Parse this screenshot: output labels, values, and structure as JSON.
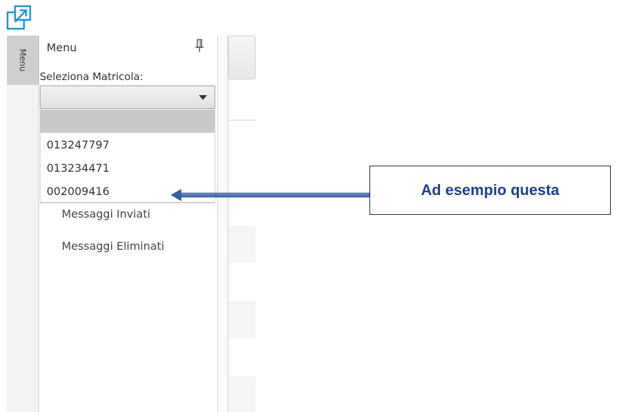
{
  "header": {
    "expand_icon": "expand-window-icon"
  },
  "side_tab": {
    "label": "Menu"
  },
  "menu": {
    "title": "Menu",
    "pin_icon": "pin-icon",
    "matricola_label": "Seleziona Matricola:",
    "selected_value": "",
    "options": [
      "013247797",
      "013234471",
      "002009416"
    ],
    "items": [
      "Messaggi Inviati",
      "Messaggi Eliminati"
    ]
  },
  "callout": {
    "text": "Ad esempio questa",
    "text_color": "#1f3f87",
    "arrow_color": "#4a6fb5"
  }
}
